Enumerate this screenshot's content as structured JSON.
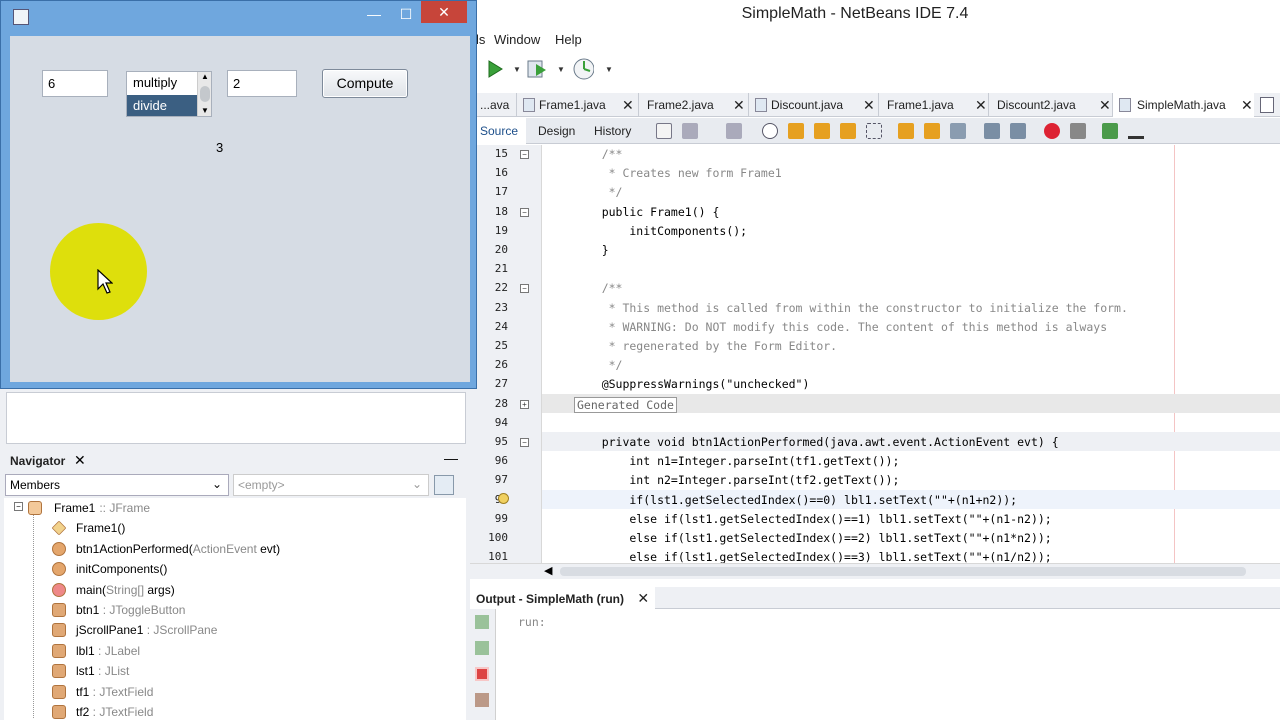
{
  "ide": {
    "title": "SimpleMath - NetBeans IDE 7.4",
    "menu": [
      "ls",
      "Window",
      "Help"
    ],
    "tabs": [
      {
        "label": "...ava"
      },
      {
        "label": "Frame1.java"
      },
      {
        "label": "Frame2.java"
      },
      {
        "label": "Discount.java"
      },
      {
        "label": "Frame1.java"
      },
      {
        "label": "Discount2.java"
      },
      {
        "label": "SimpleMath.java"
      }
    ],
    "editor_tabs": [
      "Source",
      "Design",
      "History"
    ],
    "lines": [
      {
        "n": "15",
        "text": "    /**"
      },
      {
        "n": "16",
        "text": "     * Creates new form Frame1"
      },
      {
        "n": "17",
        "text": "     */"
      },
      {
        "n": "18",
        "text": "    public Frame1() {"
      },
      {
        "n": "19",
        "text": "        initComponents();"
      },
      {
        "n": "20",
        "text": "    }"
      },
      {
        "n": "21",
        "text": ""
      },
      {
        "n": "22",
        "text": "    /**"
      },
      {
        "n": "23",
        "text": "     * This method is called from within the constructor to initialize the form."
      },
      {
        "n": "24",
        "text": "     * WARNING: Do NOT modify this code. The content of this method is always"
      },
      {
        "n": "25",
        "text": "     * regenerated by the Form Editor."
      },
      {
        "n": "26",
        "text": "     */"
      },
      {
        "n": "27",
        "text": "    @SuppressWarnings(\"unchecked\")"
      },
      {
        "n": "28",
        "text": "Generated Code"
      },
      {
        "n": "94",
        "text": ""
      },
      {
        "n": "95",
        "text": "    private void btn1ActionPerformed(java.awt.event.ActionEvent evt) {"
      },
      {
        "n": "96",
        "text": "        int n1=Integer.parseInt(tf1.getText());"
      },
      {
        "n": "97",
        "text": "        int n2=Integer.parseInt(tf2.getText());"
      },
      {
        "n": "98",
        "text": "        if(lst1.getSelectedIndex()==0) lbl1.setText(\"\"+(n1+n2));"
      },
      {
        "n": "99",
        "text": "        else if(lst1.getSelectedIndex()==1) lbl1.setText(\"\"+(n1-n2));"
      },
      {
        "n": "100",
        "text": "        else if(lst1.getSelectedIndex()==2) lbl1.setText(\"\"+(n1*n2));"
      },
      {
        "n": "101",
        "text": "        else if(lst1.getSelectedIndex()==3) lbl1.setText(\"\"+(n1/n2));"
      }
    ],
    "output_title": "Output - SimpleMath (run)",
    "output_text": "run:"
  },
  "navigator": {
    "title": "Navigator",
    "members_label": "Members",
    "filter_placeholder": "<empty>",
    "tree": [
      {
        "name": "Frame1",
        "type": ":: JFrame"
      },
      {
        "name": "Frame1()",
        "type": ""
      },
      {
        "name": "btn1ActionPerformed(",
        "type": "ActionEvent",
        "tail": " evt)"
      },
      {
        "name": "initComponents()",
        "type": ""
      },
      {
        "name": "main(",
        "type": "String[]",
        "tail": " args)"
      },
      {
        "name": "btn1",
        "type": " : JToggleButton"
      },
      {
        "name": "jScrollPane1",
        "type": " : JScrollPane"
      },
      {
        "name": "lbl1",
        "type": " : JLabel"
      },
      {
        "name": "lst1",
        "type": " : JList"
      },
      {
        "name": "tf1",
        "type": " : JTextField"
      },
      {
        "name": "tf2",
        "type": " : JTextField"
      }
    ]
  },
  "frame": {
    "tf1_value": "6",
    "tf2_value": "2",
    "list_items": [
      "multiply",
      "divide"
    ],
    "selected_item": "divide",
    "compute_label": "Compute",
    "result": "3"
  },
  "colors": {
    "frame_border": "#6fa7de",
    "close_button": "#c7453a",
    "list_selection": "#3b5f82",
    "cursor_highlight": "#dede00"
  }
}
